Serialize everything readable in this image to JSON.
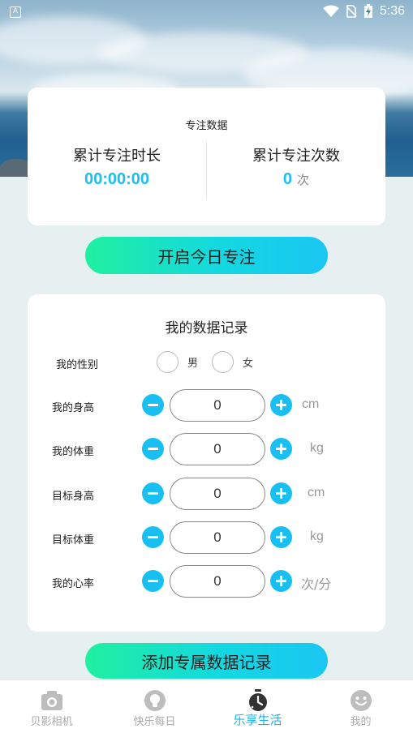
{
  "status_bar": {
    "time": "5:36",
    "app_badge": "A"
  },
  "stats": {
    "title": "专注数据",
    "total_time_label": "累计专注时长",
    "total_time_value": "00:00:00",
    "total_count_label": "累计专注次数",
    "total_count_value": "0",
    "total_count_unit": "次"
  },
  "start_button": "开启今日专注",
  "records": {
    "title": "我的数据记录",
    "gender": {
      "label": "我的性别",
      "male": "男",
      "female": "女"
    },
    "rows": [
      {
        "label": "我的身高",
        "value": "0",
        "unit": "cm"
      },
      {
        "label": "我的体重",
        "value": "0",
        "unit": "kg"
      },
      {
        "label": "目标身高",
        "value": "0",
        "unit": "cm"
      },
      {
        "label": "目标体重",
        "value": "0",
        "unit": "kg"
      },
      {
        "label": "我的心率",
        "value": "0",
        "unit": "次/分"
      }
    ]
  },
  "add_button": "添加专属数据记录",
  "tabs": [
    {
      "label": "贝影相机",
      "icon": "camera-icon",
      "active": false
    },
    {
      "label": "快乐每日",
      "icon": "lightbulb-icon",
      "active": false
    },
    {
      "label": "乐享生活",
      "icon": "stopwatch-icon",
      "active": true
    },
    {
      "label": "我的",
      "icon": "smiley-icon",
      "active": false
    }
  ],
  "colors": {
    "accent": "#18bff2",
    "gradient_start": "#1ff0a0",
    "gradient_end": "#1ac6f3",
    "background": "#e6f0f1"
  }
}
